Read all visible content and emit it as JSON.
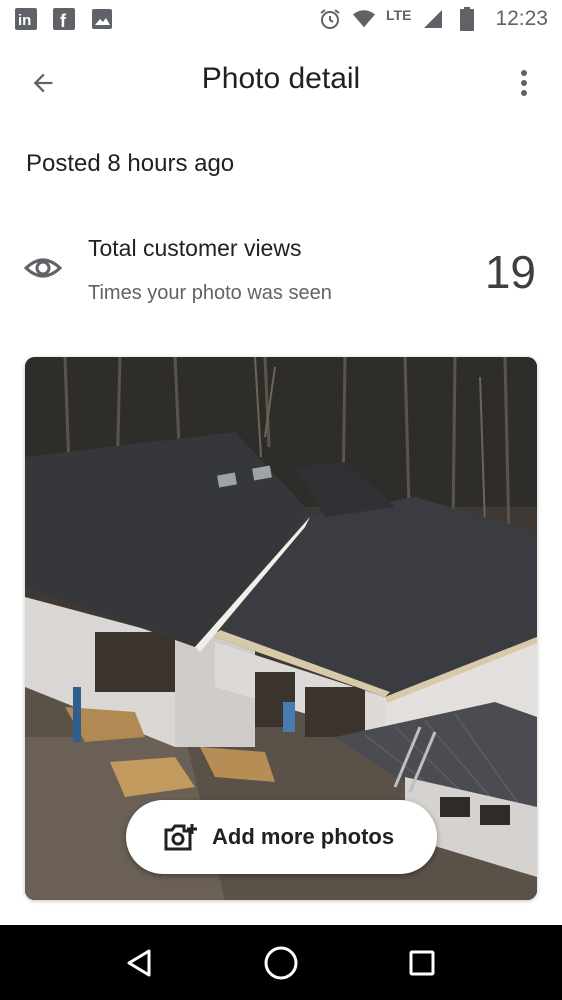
{
  "status_bar": {
    "notification_icons": [
      "linkedin-icon",
      "facebook-icon",
      "image-icon"
    ],
    "status_icons": [
      "alarm-icon",
      "wifi-icon",
      "signal-icon",
      "battery-icon"
    ],
    "network": "LTE",
    "time": "12:23"
  },
  "app_bar": {
    "title": "Photo detail",
    "back_icon": "arrow-back-icon",
    "menu_icon": "more-vert-icon"
  },
  "posted": "Posted 8 hours ago",
  "views": {
    "title": "Total customer views",
    "subtitle": "Times your photo was seen",
    "count": "19",
    "icon": "eye-icon"
  },
  "photo": {
    "alt": "aerial-house-construction-photo"
  },
  "add_button": {
    "label": "Add more photos",
    "icon": "add-photo-icon"
  },
  "nav_bar": {
    "buttons": [
      "back-triangle-icon",
      "home-circle-icon",
      "recents-square-icon"
    ]
  },
  "colors": {
    "text_primary": "#202124",
    "text_secondary": "#5f6368",
    "nav_background": "#000000"
  }
}
